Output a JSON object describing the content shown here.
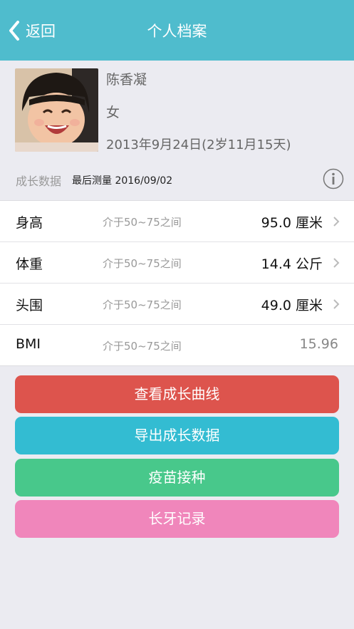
{
  "nav": {
    "back_label": "返回",
    "title": "个人档案"
  },
  "profile": {
    "name": "陈香凝",
    "gender": "女",
    "birth": "2013年9月24日(2岁11月15天)"
  },
  "growth": {
    "title": "成长数据",
    "last_measure": "最后测量 2016/09/02",
    "rows": [
      {
        "label": "身高",
        "range": "介于50~75之间",
        "value": "95.0 厘米"
      },
      {
        "label": "体重",
        "range": "介于50~75之间",
        "value": "14.4 公斤"
      },
      {
        "label": "头围",
        "range": "介于50~75之间",
        "value": "49.0 厘米"
      },
      {
        "label": "BMI",
        "range": "介于50~75之间",
        "value": "15.96"
      }
    ]
  },
  "buttons": {
    "curve": "查看成长曲线",
    "export": "导出成长数据",
    "vaccine": "疫苗接种",
    "teeth": "长牙记录"
  },
  "colors": {
    "navbar": "#4fbccd",
    "curve": "#dd544d",
    "export": "#33bcd2",
    "vaccine": "#48c88b",
    "teeth": "#f086bb"
  }
}
